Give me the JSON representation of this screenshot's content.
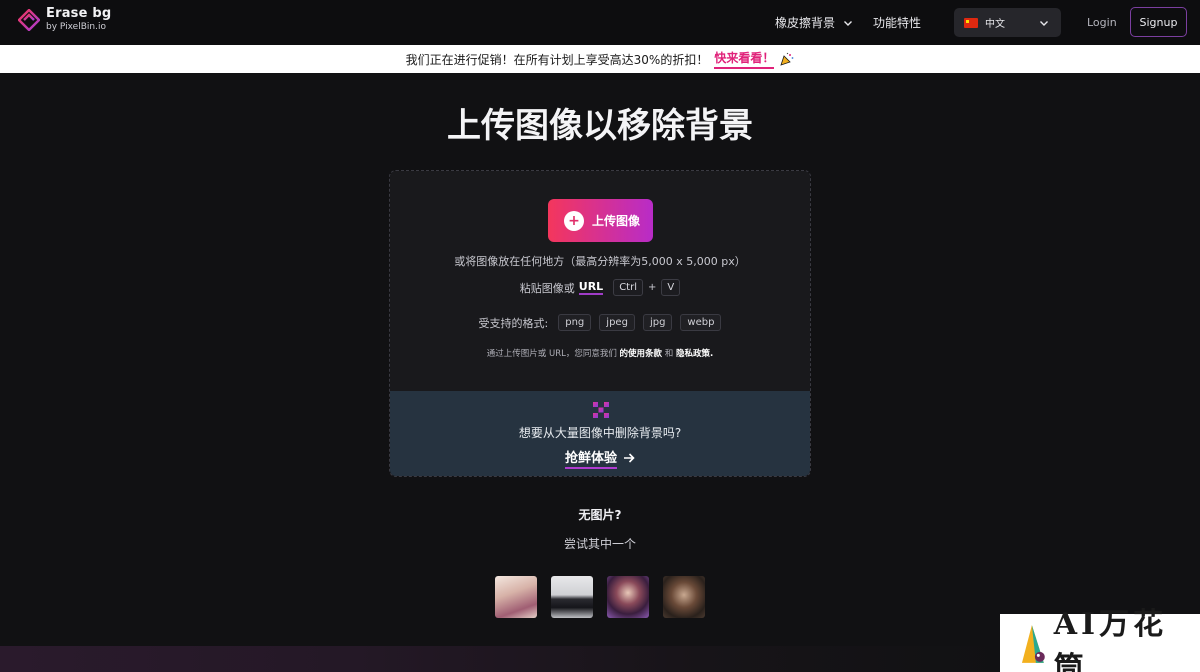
{
  "brand": {
    "name": "Erase bg",
    "by": "by PixelBin.io",
    "accent": "#e0227a"
  },
  "nav": {
    "products_label": "橡皮擦背景",
    "features_label": "功能特性",
    "language_label": "中文",
    "login_label": "Login",
    "signup_label": "Signup"
  },
  "promo": {
    "text": "我们正在进行促销！在所有计划上享受高达30%的折扣！",
    "link_label": "快来看看！"
  },
  "main": {
    "title": "上传图像以移除背景",
    "upload_button": "上传图像",
    "drop_text": "或将图像放在任何地方（最高分辨率为5,000 x 5,000 px）",
    "paste_prefix": "粘贴图像或",
    "paste_url": "URL",
    "key_ctrl": "Ctrl",
    "key_plus": "+",
    "key_v": "V",
    "formats_label": "受支持的格式:",
    "formats": [
      "png",
      "jpeg",
      "jpg",
      "webp"
    ],
    "terms_prefix": "通过上传图片或 URL，您同意我们",
    "terms_link": "的使用条款",
    "terms_and": "和",
    "privacy_link": "隐私政策."
  },
  "bulk": {
    "question": "想要从大量图像中删除背景吗?",
    "cta": "抢鲜体验"
  },
  "samples_section": {
    "title": "无图片?",
    "subtitle": "尝试其中一个"
  },
  "watermark": {
    "text": "AI万花筒"
  }
}
